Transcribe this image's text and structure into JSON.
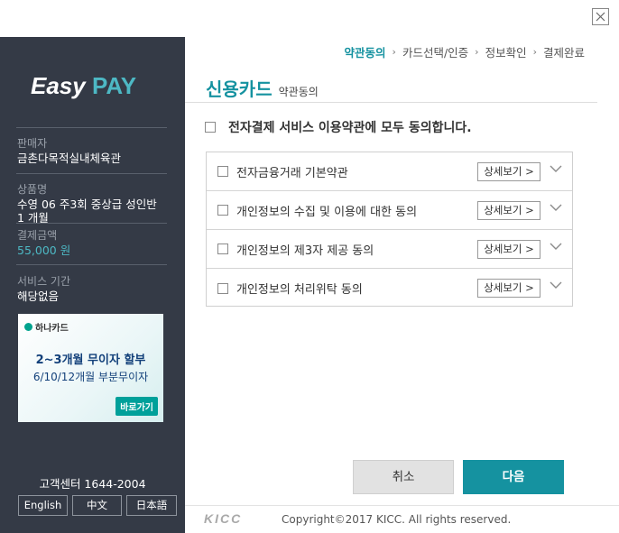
{
  "window": {
    "close_icon": "close-icon"
  },
  "sidebar": {
    "logo_text_1": "Easy",
    "logo_text_2": "PAY",
    "seller_label": "판매자",
    "seller_value": "금촌다목적실내체육관",
    "product_label": "상품명",
    "product_value": "수영 06 주3회 중상급 성인반 1 개월",
    "amount_label": "결제금액",
    "amount_value": "55,000 원",
    "service_label": "서비스 기간",
    "service_value": "해당없음",
    "banner": {
      "brand": "하나카드",
      "line1": "2~3개월 무이자 할부",
      "line2": "6/10/12개월 부분무이자",
      "button": "바로가기"
    },
    "callcenter": "고객센터 1644-2004",
    "languages": [
      "English",
      "中文",
      "日本語"
    ]
  },
  "steps": [
    "약관동의",
    "카드선택/인증",
    "정보확인",
    "결제완료"
  ],
  "title": "신용카드",
  "subtitle": "약관동의",
  "agree_all": "전자결제 서비스 이용약관에 모두 동의합니다.",
  "terms": [
    {
      "label": "전자금융거래 기본약관",
      "detail": "상세보기 >"
    },
    {
      "label": "개인정보의 수집 및 이용에 대한 동의",
      "detail": "상세보기 >"
    },
    {
      "label": "개인정보의 제3자 제공 동의",
      "detail": "상세보기 >"
    },
    {
      "label": "개인정보의 처리위탁 동의",
      "detail": "상세보기 >"
    }
  ],
  "buttons": {
    "cancel": "취소",
    "next": "다음"
  },
  "footer": {
    "logo": "KICC",
    "copyright": "Copyright©2017 KICC. All rights reserved."
  },
  "colors": {
    "accent": "#1592a0",
    "sidebar_bg": "#343a46",
    "price": "#4db8c4"
  }
}
